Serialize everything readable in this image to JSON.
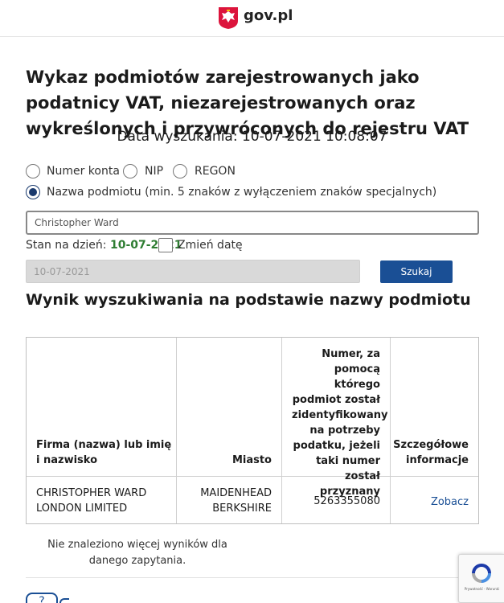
{
  "header": {
    "logo_text": "gov.pl",
    "brand_color": "#dc143c"
  },
  "page": {
    "title": "Wykaz podmiotów zarejestrowanych jako podatnicy VAT, niezarejestrowanych oraz wykreślonych i przywróconych do rejestru VAT",
    "search_date_label": "Data wyszukania: 10-07-2021 10:08:07"
  },
  "search_type": {
    "options": [
      {
        "label": "Numer konta",
        "checked": false
      },
      {
        "label": "NIP",
        "checked": false
      },
      {
        "label": "REGON",
        "checked": false
      },
      {
        "label": "Nazwa podmiotu (min. 5 znaków z wyłączeniem znaków specjalnych)",
        "checked": true
      }
    ]
  },
  "search_input": {
    "value": "Christopher Ward"
  },
  "date_filter": {
    "label": "Stan na dzień:",
    "value": "10-07-2021",
    "change_date_label": "Zmień datę",
    "change_date_checked": false,
    "date_input_value": "10-07-2021"
  },
  "actions": {
    "search_label": "Szukaj"
  },
  "results": {
    "heading": "Wynik wyszukiwania na podstawie nazwy podmiotu",
    "columns": [
      "Firma (nazwa) lub imię i nazwisko",
      "Miasto",
      "Numer, za pomocą którego podmiot został zidentyfikowany na potrzeby podatku, jeżeli taki numer został przyznany",
      "Szczegółowe informacje"
    ],
    "rows": [
      {
        "name": "CHRISTOPHER WARD LONDON LIMITED",
        "city": "MAIDENHEAD BERKSHIRE",
        "number": "5263355080",
        "details_link": "Zobacz"
      }
    ],
    "no_more_text": "Nie znaleziono więcej wyników dla danego zapytania."
  },
  "footer": {
    "help_icon": "?",
    "recaptcha_text": "Prywatność - Warunki"
  },
  "colors": {
    "accent": "#1a4f95",
    "date_green": "#2e7d32",
    "radio_checked": "#1a3a6e"
  }
}
